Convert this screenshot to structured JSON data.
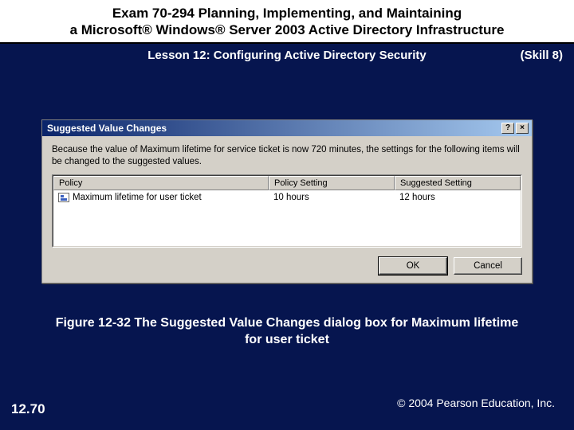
{
  "header": {
    "line1": "Exam 70-294 Planning, Implementing, and Maintaining",
    "line2": "a Microsoft® Windows® Server 2003 Active Directory Infrastructure"
  },
  "lesson": "Lesson 12: Configuring Active Directory Security",
  "skill": "(Skill 8)",
  "dialog": {
    "title": "Suggested Value Changes",
    "help_glyph": "?",
    "close_glyph": "×",
    "message": "Because the value of Maximum lifetime for service ticket is now 720 minutes, the settings for the following items will be changed to the suggested values.",
    "columns": {
      "policy": "Policy",
      "setting": "Policy Setting",
      "suggested": "Suggested Setting"
    },
    "rows": [
      {
        "policy": "Maximum lifetime for user ticket",
        "setting": "10 hours",
        "suggested": "12 hours"
      }
    ],
    "ok": "OK",
    "cancel": "Cancel"
  },
  "caption": "Figure 12-32 The Suggested Value Changes dialog box for Maximum lifetime for user ticket",
  "page": "12.70",
  "copyright": "© 2004 Pearson Education, Inc."
}
